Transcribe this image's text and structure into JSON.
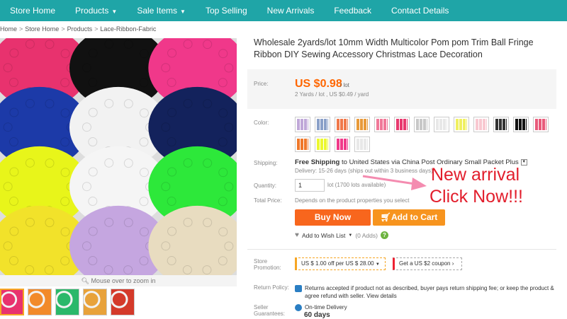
{
  "nav": {
    "items": [
      {
        "label": "Store Home",
        "caret": ""
      },
      {
        "label": "Products",
        "caret": "▼"
      },
      {
        "label": "Sale Items",
        "caret": "▼"
      },
      {
        "label": "Top Selling",
        "caret": ""
      },
      {
        "label": "New Arrivals",
        "caret": ""
      },
      {
        "label": "Feedback",
        "caret": ""
      },
      {
        "label": "Contact Details",
        "caret": ""
      }
    ]
  },
  "breadcrumb": [
    "Home",
    "Store Home",
    "Products",
    "Lace-Ribbon-Fabric"
  ],
  "breadcrumb_sep": ">",
  "gallery": {
    "zoom_hint": "Mouse over to zoom in",
    "tiles": [
      "#e8326e",
      "#111111",
      "#f0388a",
      "#1c3aa8",
      "#f2f2f2",
      "#13225c",
      "#e8f51a",
      "#f5f5f5",
      "#2de83a",
      "#f2e22a",
      "#c5a6e0",
      "#e8dcc0"
    ],
    "thumbs": [
      "#e8326e",
      "#f28a2a",
      "#2ab86a",
      "#e8a23a",
      "#d43a2a"
    ]
  },
  "product": {
    "title": "Wholesale 2yards/lot 10mm Width Multicolor Pom pom Trim Ball Fringe Ribbon DIY Sewing Accessory Christmas Lace Decoration",
    "price_label": "Price:",
    "price": "US $0.98",
    "price_unit": "/ lot",
    "price_sub": "2 Yards / lot , US $0.49 / yard",
    "color_label": "Color:",
    "colors": [
      "#c0a8d8",
      "#8aa0c8",
      "#f0784a",
      "#e89a3a",
      "#f07898",
      "#e8386e",
      "#c8c8c8",
      "#e8e8e8",
      "#f0f060",
      "#f8c8d0",
      "#333333",
      "#111111",
      "#e85a7a",
      "#f0782a",
      "#ecf830",
      "#f03a8a",
      "#e8e8e8"
    ],
    "shipping_label": "Shipping:",
    "shipping_free": "Free Shipping",
    "shipping_to": "to",
    "shipping_dest": "United States via China Post Ordinary Small Packet Plus",
    "delivery": "Delivery: 15-26 days (ships out within 3 business days)",
    "quantity_label": "Quantity:",
    "quantity_value": "1",
    "quantity_note": "lot (1700 lots available)",
    "total_label": "Total Price:",
    "total_note": "Depends on the product properties you select",
    "buy_now": "Buy Now",
    "add_to_cart": "Add to Cart",
    "wishlist": "Add to Wish List",
    "wishlist_caret": "▼",
    "wishlist_count": "(0 Adds)",
    "help": "?",
    "promo_label": "Store Promotion:",
    "promo1": "US $ 1.00 off per US $ 28.00",
    "promo2": "Get a US $2 coupon",
    "return_label": "Return Policy:",
    "return_text": "Returns accepted if product not as described, buyer pays return shipping fee; or keep the product & agree refund with seller. View details",
    "guarantee_label": "Seller Guarantees:",
    "guarantee_text": "On-time Delivery",
    "guarantee_days": "60 days"
  },
  "overlay": {
    "line1": "New arrival",
    "line2": "Click Now!!!"
  },
  "colors": {
    "nav_bg": "#1fa5a7",
    "price": "#ff6600",
    "buy": "#f8661d",
    "cart": "#f7941e",
    "overlay": "#e21e2c"
  }
}
